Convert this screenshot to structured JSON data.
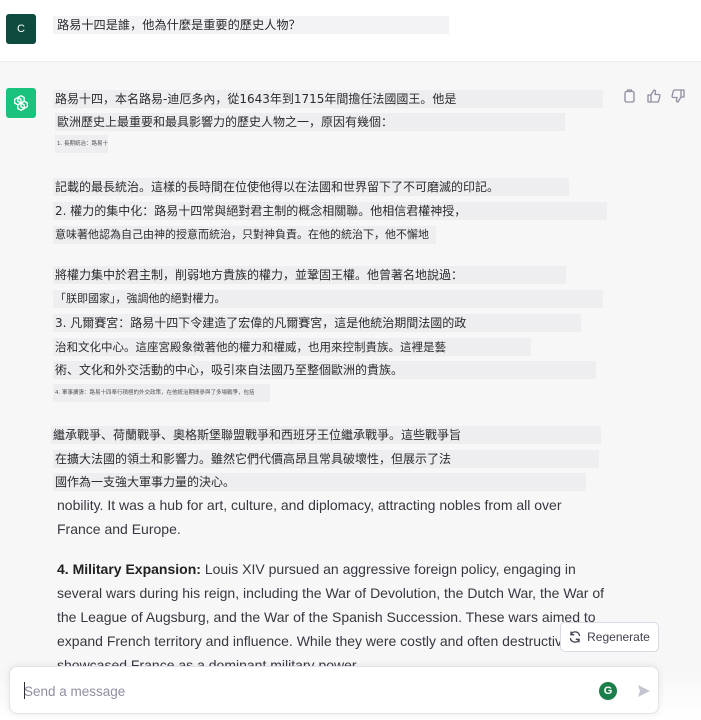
{
  "user": {
    "avatar_letter": "C",
    "message": "路易十四是誰，他為什麼是重要的歷史人物？"
  },
  "assistant": {
    "zh_lines": [
      "路易十四，本名路易-迪厄多內，從1643年到1715年間擔任法國國王。他是",
      "歐洲歷史上最重要和最具影響力的歷史人物之一，原因有幾個：",
      "1. 長期統治：路易十四在位72年",
      "記載的最長統治。這樣的長時間在位使他得以在法國和世界留下了不可磨滅的印記。",
      "2. 權力的集中化：路易十四常與絕對君主制的概念相關聯。他相信君權神授，",
      "意味著他認為自己由神的授意而統治，只對神負責。在他的統治下，他不懈地",
      "將權力集中於君主制，削弱地方貴族的權力，並鞏固王權。他曾著名地說過：",
      "「朕即國家」，強調他的絕對權力。",
      "3. 凡爾賽宮：路易十四下令建造了宏偉的凡爾賽宮，這是他統治期間法國的政",
      "治和文化中心。這座宮殿象徵著他的權力和權威，也用來控制貴族。這裡是藝",
      "術、文化和外交活動的中心，吸引來自法國乃至整個歐洲的貴族。",
      "4. 軍事擴張：路易十四奉行積極的外交政策，在他統治期間參與了多場戰爭，包括",
      "繼承戰爭、荷蘭戰爭、奧格斯堡聯盟戰爭和西班牙王位繼承戰爭。這些戰爭旨",
      "在擴大法國的領土和影響力。雖然它們代價高昂且常具破壞性，但展示了法",
      "國作為一支強大軍事力量的決心。"
    ],
    "en_p1": "nobility. It was a hub for art, culture, and diplomacy, attracting nobles from all over France and Europe.",
    "en_p2_bold": "4. Military Expansion:",
    "en_p2_rest": " Louis XIV pursued an aggressive foreign policy, engaging in several wars during his reign, including the War of Devolution, the Dutch War, the War of the League of Augsburg, and the War of the Spanish Succession. These wars aimed to expand French territory and influence. While they were costly and often destructive, they showcased France as a dominant military power."
  },
  "regenerate_label": "Regenerate",
  "composer": {
    "placeholder": "Send a message",
    "badge_letter": "G"
  },
  "colors": {
    "user_avatar": "#0f4a3f",
    "assistant_avatar": "#19c37d",
    "assistant_bg": "#f7f7f8",
    "badge": "#1a7f4b"
  }
}
